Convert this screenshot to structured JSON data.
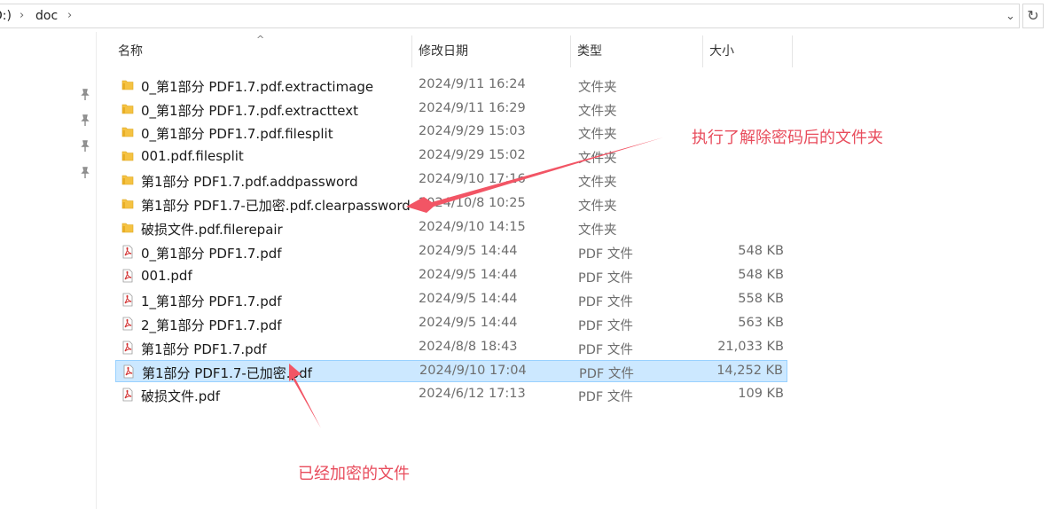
{
  "address": {
    "drive_fragment": "D:)",
    "folder": "doc"
  },
  "columns": {
    "name": "名称",
    "date": "修改日期",
    "type": "类型",
    "size": "大小"
  },
  "files": [
    {
      "name": "0_第1部分 PDF1.7.pdf.extractimage",
      "date": "2024/9/11 16:24",
      "type": "文件夹",
      "size": "",
      "kind": "folder"
    },
    {
      "name": "0_第1部分 PDF1.7.pdf.extracttext",
      "date": "2024/9/11 16:29",
      "type": "文件夹",
      "size": "",
      "kind": "folder"
    },
    {
      "name": "0_第1部分 PDF1.7.pdf.filesplit",
      "date": "2024/9/29 15:03",
      "type": "文件夹",
      "size": "",
      "kind": "folder"
    },
    {
      "name": "001.pdf.filesplit",
      "date": "2024/9/29 15:02",
      "type": "文件夹",
      "size": "",
      "kind": "folder"
    },
    {
      "name": "第1部分 PDF1.7.pdf.addpassword",
      "date": "2024/9/10 17:16",
      "type": "文件夹",
      "size": "",
      "kind": "folder"
    },
    {
      "name": "第1部分 PDF1.7-已加密.pdf.clearpassword",
      "date": "2024/10/8 10:25",
      "type": "文件夹",
      "size": "",
      "kind": "folder"
    },
    {
      "name": "破损文件.pdf.filerepair",
      "date": "2024/9/10 14:15",
      "type": "文件夹",
      "size": "",
      "kind": "folder"
    },
    {
      "name": "0_第1部分 PDF1.7.pdf",
      "date": "2024/9/5 14:44",
      "type": "PDF 文件",
      "size": "548 KB",
      "kind": "pdf"
    },
    {
      "name": "001.pdf",
      "date": "2024/9/5 14:44",
      "type": "PDF 文件",
      "size": "548 KB",
      "kind": "pdf"
    },
    {
      "name": "1_第1部分 PDF1.7.pdf",
      "date": "2024/9/5 14:44",
      "type": "PDF 文件",
      "size": "558 KB",
      "kind": "pdf"
    },
    {
      "name": "2_第1部分 PDF1.7.pdf",
      "date": "2024/9/5 14:44",
      "type": "PDF 文件",
      "size": "563 KB",
      "kind": "pdf"
    },
    {
      "name": "第1部分 PDF1.7.pdf",
      "date": "2024/8/8 18:43",
      "type": "PDF 文件",
      "size": "21,033 KB",
      "kind": "pdf"
    },
    {
      "name": "第1部分 PDF1.7-已加密.pdf",
      "date": "2024/9/10 17:04",
      "type": "PDF 文件",
      "size": "14,252 KB",
      "kind": "pdf",
      "selected": true
    },
    {
      "name": "破损文件.pdf",
      "date": "2024/6/12 17:13",
      "type": "PDF 文件",
      "size": "109 KB",
      "kind": "pdf"
    }
  ],
  "annotations": {
    "top": "执行了解除密码后的文件夹",
    "bottom": "已经加密的文件"
  },
  "colors": {
    "selection_bg": "#cce8ff",
    "selection_border": "#99d1ff",
    "annotation": "#e84c5c",
    "folder": "#f5c242"
  },
  "icons": {
    "folder": "folder-icon",
    "pdf": "pdf-file-icon",
    "pin": "pin-icon",
    "refresh": "refresh-icon",
    "chevron": "chevron-right-icon"
  }
}
